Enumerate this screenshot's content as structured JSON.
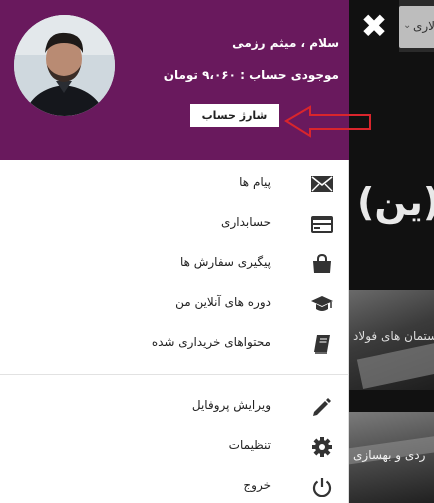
{
  "profile": {
    "greeting": "سلام ، میثم رزمی",
    "balance": "موجودی حساب : ۹،۰۶۰ تومان",
    "charge_button": "شارژ حساب"
  },
  "menu": {
    "items": [
      {
        "label": "پیام ها",
        "icon": "envelope-icon"
      },
      {
        "label": "حسابداری",
        "icon": "credit-card-icon"
      },
      {
        "label": "پیگیری سفارش ها",
        "icon": "shopping-bag-icon"
      },
      {
        "label": "دوره های آنلاین من",
        "icon": "graduation-cap-icon"
      },
      {
        "label": "محتواهای خریداری شده",
        "icon": "book-icon"
      }
    ],
    "account_items": [
      {
        "label": "ویرایش پروفایل",
        "icon": "pencil-icon"
      },
      {
        "label": "تنظیمات",
        "icon": "gear-icon"
      },
      {
        "label": "خروج",
        "icon": "power-icon"
      }
    ]
  },
  "background": {
    "select_text": "لاری",
    "headline": "(ین)",
    "card1_text": "ستمان های فولاد",
    "card2_text": "ردی و بهسازی"
  },
  "colors": {
    "header": "#69195d",
    "arrow": "#d9252c"
  }
}
